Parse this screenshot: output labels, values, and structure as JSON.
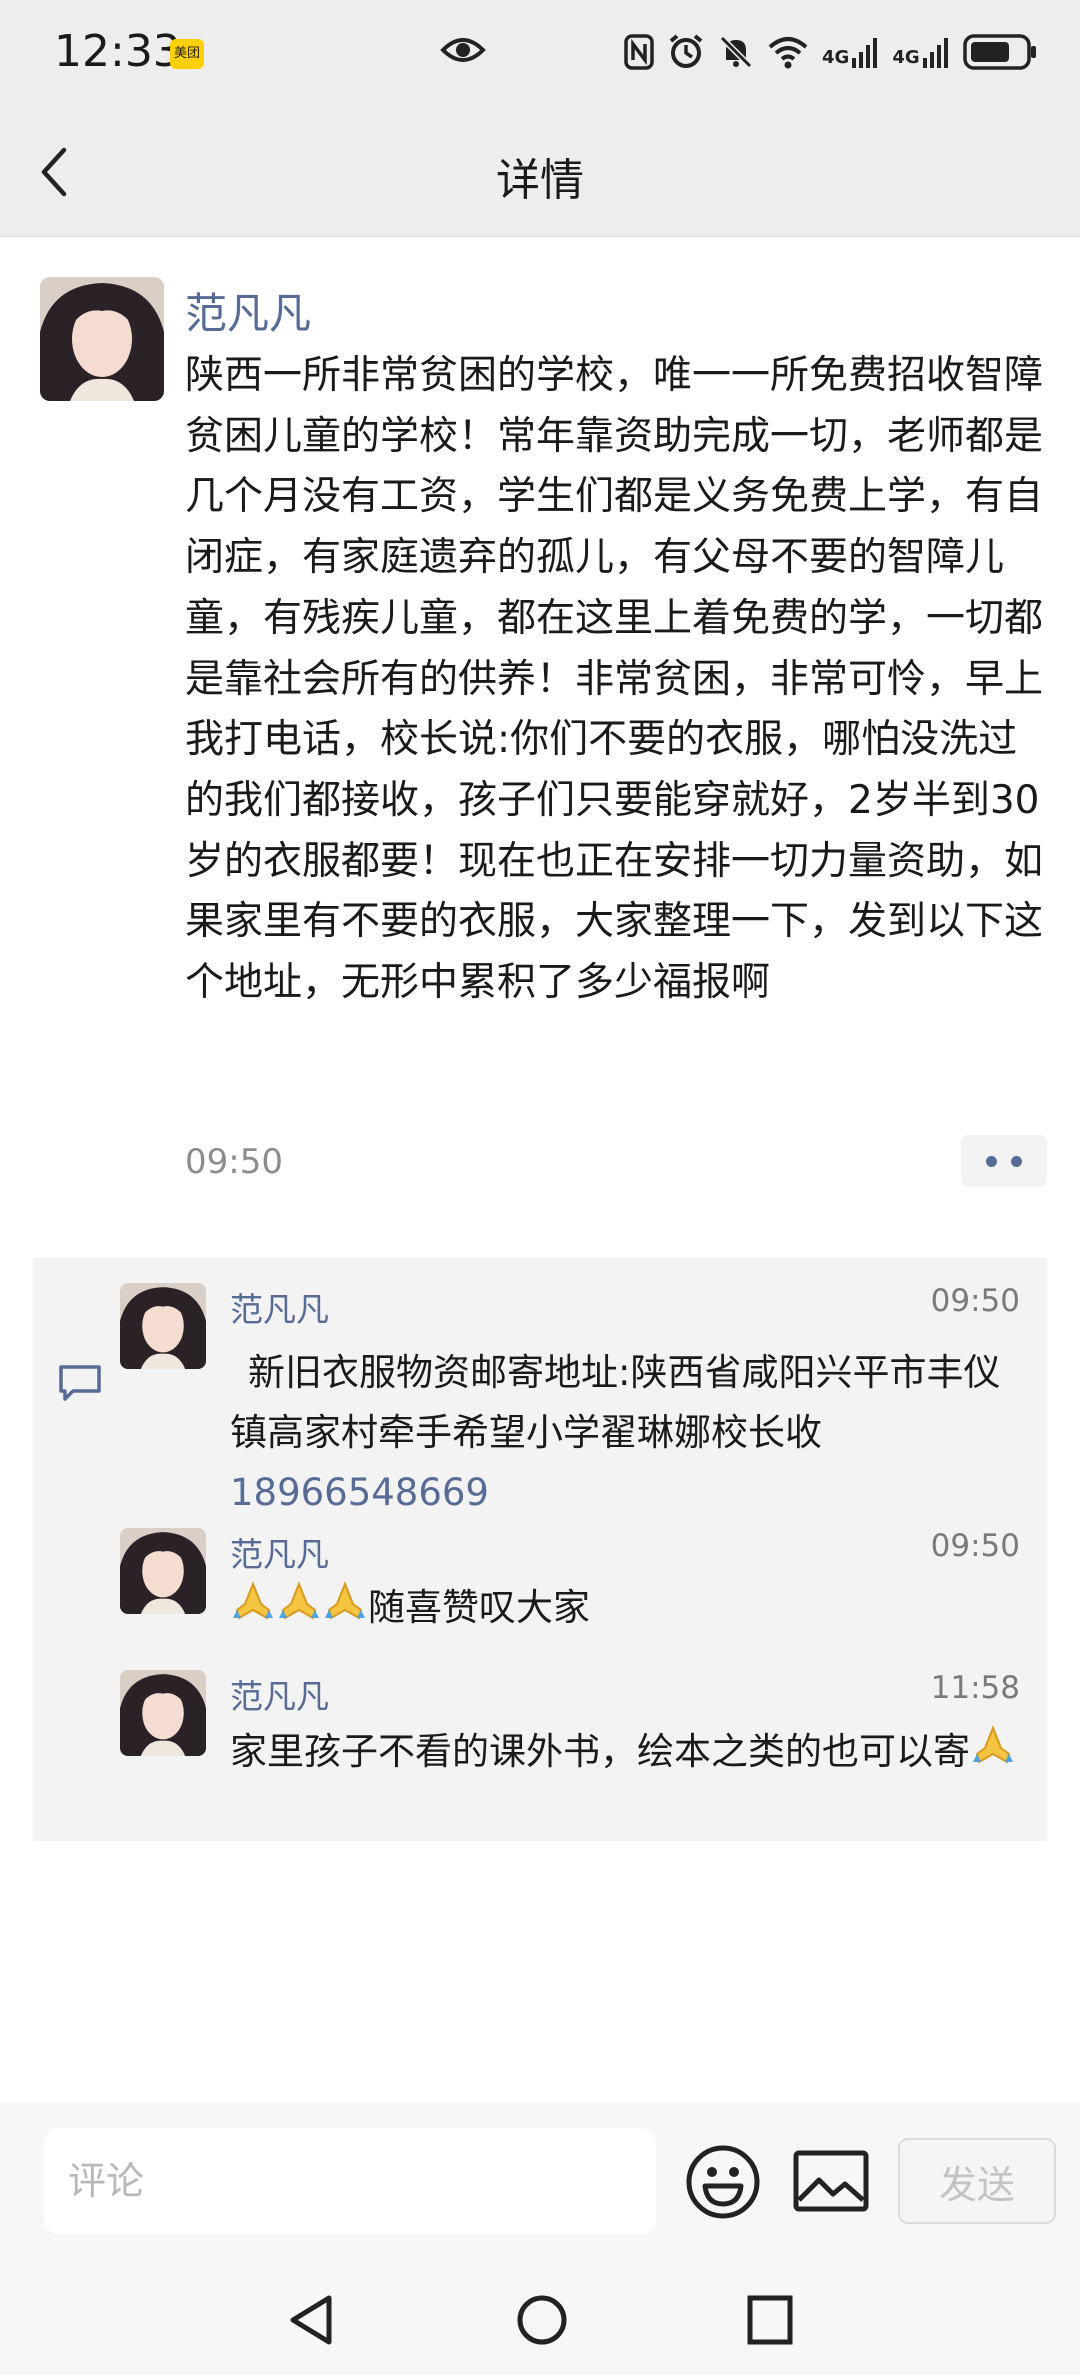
{
  "status_bar": {
    "time": "12:33",
    "badge": "美团",
    "network1": "4G",
    "network2": "4G",
    "icons": [
      "eye-icon",
      "nfc-icon",
      "alarm-icon",
      "mute-icon",
      "wifi-icon",
      "signal-icon",
      "battery-icon"
    ]
  },
  "header": {
    "title": "详情"
  },
  "post": {
    "author": "范凡凡",
    "text": "陕西一所非常贫困的学校，唯一一所免费招收智障贫困儿童的学校！常年靠资助完成一切，老师都是几个月没有工资，学生们都是义务免费上学，有自闭症，有家庭遗弃的孤儿，有父母不要的智障儿童，有残疾儿童，都在这里上着免费的学，一切都是靠社会所有的供养！非常贫困，非常可怜，早上我打电话，校长说:你们不要的衣服，哪怕没洗过的我们都接收，孩子们只要能穿就好，2岁半到30岁的衣服都要！现在也正在安排一切力量资助，如果家里有不要的衣服，大家整理一下，发到以下这个地址，无形中累积了多少福报啊",
    "time": "09:50"
  },
  "comments": [
    {
      "author": "范凡凡",
      "time": "09:50",
      "text": "新旧衣服物资邮寄地址:陕西省咸阳兴平市丰仪镇高家村牵手希望小学翟琳娜校长收",
      "phone": "18966548669"
    },
    {
      "author": "范凡凡",
      "time": "09:50",
      "text": "随喜赞叹大家"
    },
    {
      "author": "范凡凡",
      "time": "11:58",
      "text": "家里孩子不看的课外书，绘本之类的也可以寄"
    }
  ],
  "input_bar": {
    "placeholder": "评论",
    "send_label": "发送"
  },
  "colors": {
    "link_blue": "#576b95",
    "bar_gray": "#ededed",
    "comment_bg": "#f3f3f3"
  }
}
